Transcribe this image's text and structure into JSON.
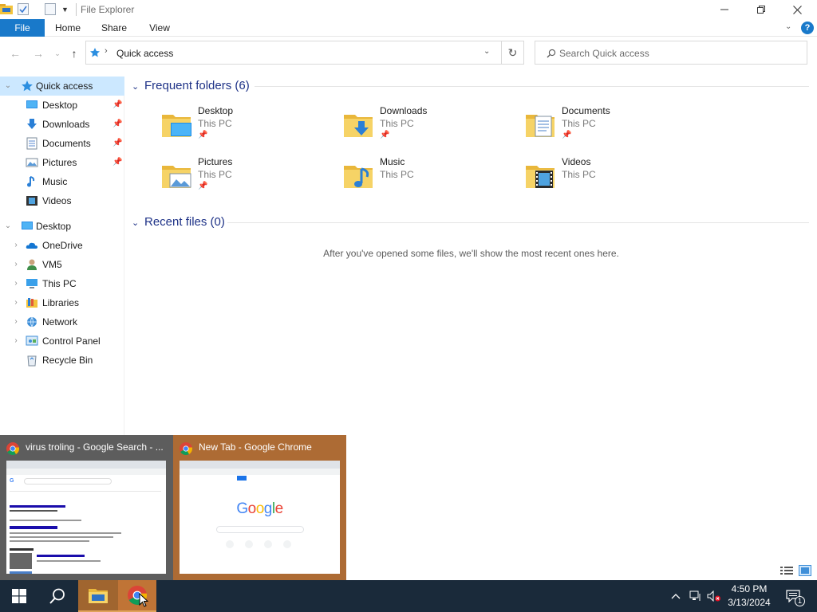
{
  "window": {
    "title": "File Explorer",
    "controls": {
      "minimize": "—",
      "maximize": "❐",
      "close": "✕"
    }
  },
  "ribbon": {
    "tabs": [
      {
        "label": "File"
      },
      {
        "label": "Home"
      },
      {
        "label": "Share"
      },
      {
        "label": "View"
      }
    ]
  },
  "address": {
    "path": "Quick access",
    "search_placeholder": "Search Quick access"
  },
  "nav_pane": {
    "quick_access": {
      "label": "Quick access",
      "items": [
        {
          "label": "Desktop",
          "icon": "desktop-icon",
          "pinned": true
        },
        {
          "label": "Downloads",
          "icon": "downloads-icon",
          "pinned": true
        },
        {
          "label": "Documents",
          "icon": "documents-icon",
          "pinned": true
        },
        {
          "label": "Pictures",
          "icon": "pictures-icon",
          "pinned": true
        },
        {
          "label": "Music",
          "icon": "music-icon",
          "pinned": false
        },
        {
          "label": "Videos",
          "icon": "videos-icon",
          "pinned": false
        }
      ]
    },
    "desktop_tree": {
      "label": "Desktop",
      "items": [
        {
          "label": "OneDrive",
          "icon": "onedrive-icon"
        },
        {
          "label": "VM5",
          "icon": "user-icon"
        },
        {
          "label": "This PC",
          "icon": "this-pc-icon"
        },
        {
          "label": "Libraries",
          "icon": "libraries-icon"
        },
        {
          "label": "Network",
          "icon": "network-icon"
        },
        {
          "label": "Control Panel",
          "icon": "control-panel-icon"
        },
        {
          "label": "Recycle Bin",
          "icon": "recycle-bin-icon"
        }
      ]
    }
  },
  "content": {
    "frequent_folders": {
      "heading": "Frequent folders (6)",
      "items": [
        {
          "name": "Desktop",
          "location": "This PC",
          "pinned": true,
          "icon": "desktop-folder-icon"
        },
        {
          "name": "Downloads",
          "location": "This PC",
          "pinned": true,
          "icon": "downloads-folder-icon"
        },
        {
          "name": "Documents",
          "location": "This PC",
          "pinned": true,
          "icon": "documents-folder-icon"
        },
        {
          "name": "Pictures",
          "location": "This PC",
          "pinned": true,
          "icon": "pictures-folder-icon"
        },
        {
          "name": "Music",
          "location": "This PC",
          "pinned": false,
          "icon": "music-folder-icon"
        },
        {
          "name": "Videos",
          "location": "This PC",
          "pinned": false,
          "icon": "videos-folder-icon"
        }
      ]
    },
    "recent_files": {
      "heading": "Recent files (0)",
      "empty_message": "After you've opened some files, we'll show the most recent ones here."
    }
  },
  "taskbar_previews": [
    {
      "title": "virus troling - Google Search - ...",
      "app": "Google Chrome"
    },
    {
      "title": "New Tab - Google Chrome",
      "app": "Google Chrome",
      "logo_text": "Google"
    }
  ],
  "taskbar": {
    "time": "4:50 PM",
    "date": "3/13/2024",
    "notification_count": "1"
  },
  "colors": {
    "accent": "#1979ca",
    "selection": "#cce8ff",
    "group_heading": "#1e3287",
    "taskbar": "#1a2a3a",
    "thumb_active": "#ad6b34"
  }
}
